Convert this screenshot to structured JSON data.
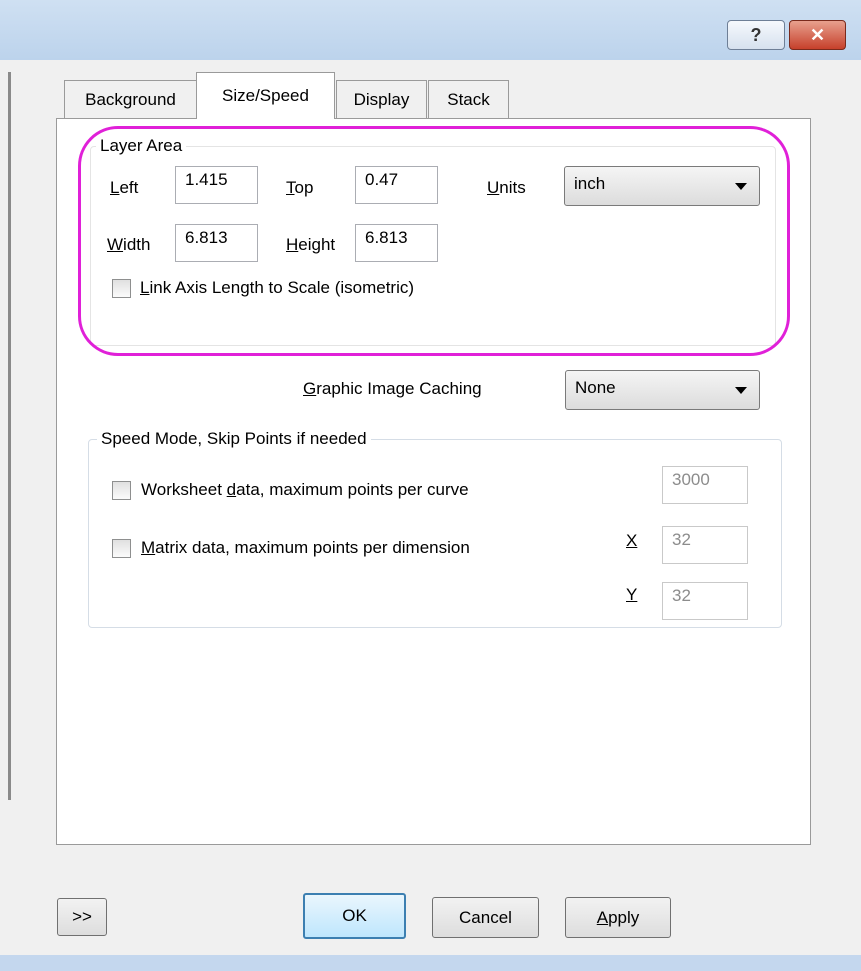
{
  "titlebar": {
    "help_label": "?",
    "close_label": "✕"
  },
  "tabs": [
    {
      "label": "Background",
      "active": false
    },
    {
      "label": "Size/Speed",
      "active": true
    },
    {
      "label": "Display",
      "active": false
    },
    {
      "label": "Stack",
      "active": false
    }
  ],
  "layer_area": {
    "title": "Layer Area",
    "left": {
      "label_ul": "L",
      "label_rest": "eft",
      "value": "1.415"
    },
    "top": {
      "label_ul": "T",
      "label_rest": "op",
      "value": "0.47"
    },
    "units": {
      "label_ul": "U",
      "label_rest": "nits",
      "value": "inch"
    },
    "width": {
      "label_ul": "W",
      "label_rest": "idth",
      "value": "6.813"
    },
    "height": {
      "label_ul": "H",
      "label_rest": "eight",
      "value": "6.813"
    },
    "link_checkbox": {
      "label_ul": "L",
      "label_rest": "ink Axis Length to Scale (isometric)",
      "checked": false
    }
  },
  "caching": {
    "label_ul": "G",
    "label_rest": "raphic Image Caching",
    "value": "None"
  },
  "speed_mode": {
    "title": "Speed Mode, Skip Points if needed",
    "worksheet": {
      "label_pre": "Worksheet ",
      "label_ul": "d",
      "label_rest": "ata, maximum points per curve",
      "value": "3000",
      "checked": false
    },
    "matrix": {
      "label_ul": "M",
      "label_rest": "atrix data, maximum points per dimension",
      "checked": false
    },
    "x": {
      "label": "X",
      "value": "32"
    },
    "y": {
      "label": "Y",
      "value": "32"
    }
  },
  "buttons": {
    "expand": ">>",
    "ok": "OK",
    "cancel": "Cancel",
    "apply_ul": "A",
    "apply_rest": "pply"
  },
  "colors": {
    "highlight": "#e020d8",
    "titlebar": "#bcd3ec",
    "close": "#c6402b"
  }
}
